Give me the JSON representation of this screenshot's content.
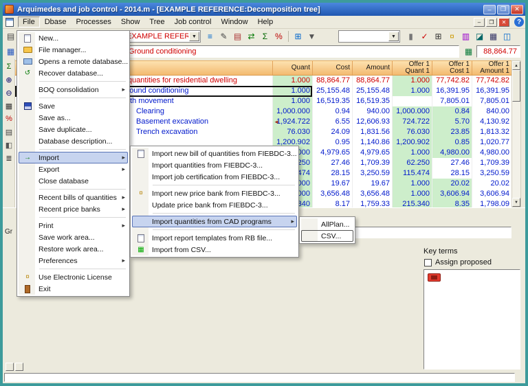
{
  "window": {
    "title": "Arquimedes and job control - 2014.m - [EXAMPLE REFERENCE:Decomposition tree]",
    "controls": {
      "minimize": "–",
      "maximize": "❐",
      "close": "✕",
      "help": "?"
    }
  },
  "menubar": [
    "File",
    "Dbase",
    "Processes",
    "Show",
    "Tree",
    "Job control",
    "Window",
    "Help"
  ],
  "toolbar": {
    "reference_value": "EXAMPLE REFERENCE",
    "summary_value": "Ground conditioning",
    "total_value": "88,864.77"
  },
  "table": {
    "headers": {
      "quant": "Quant",
      "cost": "Cost",
      "amount": "Amount",
      "offer_quant_1": "Offer 1",
      "offer_quant_2": "Quant 1",
      "offer_cost_1": "Offer 1",
      "offer_cost_2": "Cost 1",
      "offer_amount_1": "Offer 1",
      "offer_amount_2": "Amount 1"
    },
    "rows": [
      {
        "summary": "Bill of quantities for residential dwelling",
        "quant": "1.000",
        "cost": "88,864.77",
        "amount": "88,864.77",
        "oquant": "1.000",
        "ocost": "77,742.82",
        "oamount": "77,742.82"
      },
      {
        "summary": "Ground conditioning",
        "quant": "1.000",
        "cost": "25,155.48",
        "amount": "25,155.48",
        "oquant": "1.000",
        "ocost": "16,391.95",
        "oamount": "16,391.95"
      },
      {
        "summary": "Earth movement",
        "quant": "1.000",
        "cost": "16,519.35",
        "amount": "16,519.35",
        "oquant": "",
        "ocost": "7,805.01",
        "oamount": "7,805.01"
      },
      {
        "summary": "Clearing",
        "quant": "1,000.000",
        "cost": "0.94",
        "amount": "940.00",
        "oquant": "1,000.000",
        "ocost": "0.84",
        "oamount": "840.00"
      },
      {
        "summary": "Basement excavation",
        "marker": "◄",
        "quant": "1,924.722",
        "cost": "6.55",
        "amount": "12,606.93",
        "oquant": "724.722",
        "ocost": "5.70",
        "oamount": "4,130.92"
      },
      {
        "summary": "Trench excavation",
        "quant": "76.030",
        "cost": "24.09",
        "amount": "1,831.56",
        "oquant": "76.030",
        "ocost": "23.85",
        "oamount": "1,813.32"
      },
      {
        "summary": "",
        "quant": "1,200.902",
        "cost": "0.95",
        "amount": "1,140.86",
        "oquant": "1,200.902",
        "ocost": "0.85",
        "oamount": "1,020.77"
      },
      {
        "summary": "",
        "quant": "1.000",
        "cost": "4,979.65",
        "amount": "4,979.65",
        "oquant": "1.000",
        "ocost": "4,980.00",
        "oamount": "4,980.00"
      },
      {
        "summary": "",
        "quant": "62.250",
        "cost": "27.46",
        "amount": "1,709.39",
        "oquant": "62.250",
        "ocost": "27.46",
        "oamount": "1,709.39"
      },
      {
        "summary": "",
        "quant": "115.474",
        "cost": "28.15",
        "amount": "3,250.59",
        "oquant": "115.474",
        "ocost": "28.15",
        "oamount": "3,250.59"
      },
      {
        "summary": "",
        "quant": "1.000",
        "cost": "19.67",
        "amount": "19.67",
        "oquant": "1.000",
        "ocost": "20.02",
        "oamount": "20.02"
      },
      {
        "summary": "",
        "quant": "1.000",
        "cost": "3,656.48",
        "amount": "3,656.48",
        "oquant": "1.000",
        "ocost": "3,606.94",
        "oamount": "3,606.94"
      },
      {
        "summary": "",
        "quant": "215.340",
        "cost": "8.17",
        "amount": "1,759.33",
        "oquant": "215.340",
        "ocost": "8.35",
        "oamount": "1,798.09"
      }
    ]
  },
  "menus": {
    "file": [
      "New...",
      "File manager...",
      "Opens a remote database...",
      "Recover database...",
      "BOQ consolidation",
      "Save",
      "Save as...",
      "Save duplicate...",
      "Database description...",
      "Import",
      "Export",
      "Close database",
      "Recent bills of quantities",
      "Recent price banks",
      "Print",
      "Save work area...",
      "Restore work area...",
      "Preferences",
      "Use Electronic License",
      "Exit"
    ],
    "import": [
      "Import new bill of quantities from FIEBDC-3...",
      "Import quantities from FIEBDC-3...",
      "Import job certification from FIEBDC-3...",
      "Import new price bank from FIEBDC-3...",
      "Update price bank from FIEBDC-3...",
      "Import quantities from CAD programs",
      "Import report templates from RB file...",
      "Import from CSV..."
    ],
    "cad": [
      "AllPlan...",
      "CSV..."
    ]
  },
  "lower": {
    "key_terms_label": "Key terms",
    "assign_proposed_label": "Assign proposed",
    "gr_label": "Gr"
  },
  "icons": {
    "printer": "▤",
    "preview": "◫",
    "pages": "▥",
    "new_doc": "□",
    "save": "▣",
    "hierarchy": "≡",
    "edit": "✎",
    "swap": "⇄",
    "sum": "Σ",
    "percent": "%",
    "grid_plus": "⊞",
    "filter": "▼",
    "usb": "▮",
    "check": "✓",
    "calculator": "⊞",
    "coins": "¤",
    "book": "▥",
    "chart": "◪",
    "grid": "▦",
    "window": "◫",
    "zoom_in": "⊕",
    "zoom_out": "⊖",
    "columns": "▦",
    "lock": "◧",
    "rows_ic": "▤",
    "split": "◨",
    "list": "≣",
    "up": "▲",
    "down": "▼",
    "recover": "↺",
    "import_arrow": "→",
    "license": "¤",
    "csv": "▦",
    "bank": "¤",
    "sum_grid": "▦",
    "grid_blue": "▦"
  },
  "colors": {
    "red_text": "#cf0000",
    "blue_text": "#0018cc",
    "green_cell": "#cdeecb",
    "header_orange": "#f3ba70",
    "title_blue": "#2f66c4",
    "window_border_teal": "#3d9b9b",
    "menu_highlight": "#c7d4ef",
    "tag_red": "#e23b2e"
  }
}
